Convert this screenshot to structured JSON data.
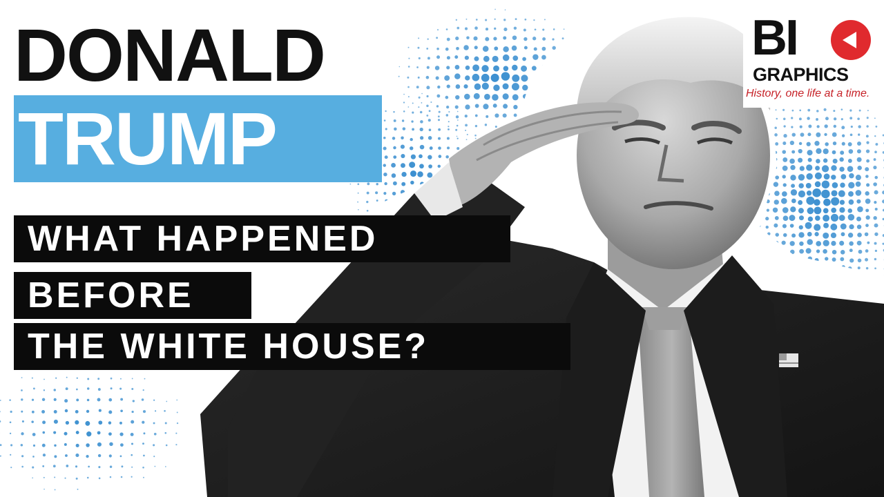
{
  "thumbnail": {
    "title_line1": "DONALD",
    "title_line2": "TRUMP",
    "subtitle_lines": [
      "WHAT HAPPENED",
      "BEFORE",
      "THE WHITE HOUSE?"
    ]
  },
  "logo": {
    "wordmark_top": "BI",
    "wordmark_bottom": "GRAPHICS",
    "tagline": "History, one life at a time.",
    "icon": "play-circle-icon"
  },
  "colors": {
    "accent_blue": "#57aee0",
    "halftone_blue": "#3b8fd0",
    "label_black": "#0b0b0b",
    "logo_red": "#e02a2e",
    "tagline_red": "#c62127"
  }
}
